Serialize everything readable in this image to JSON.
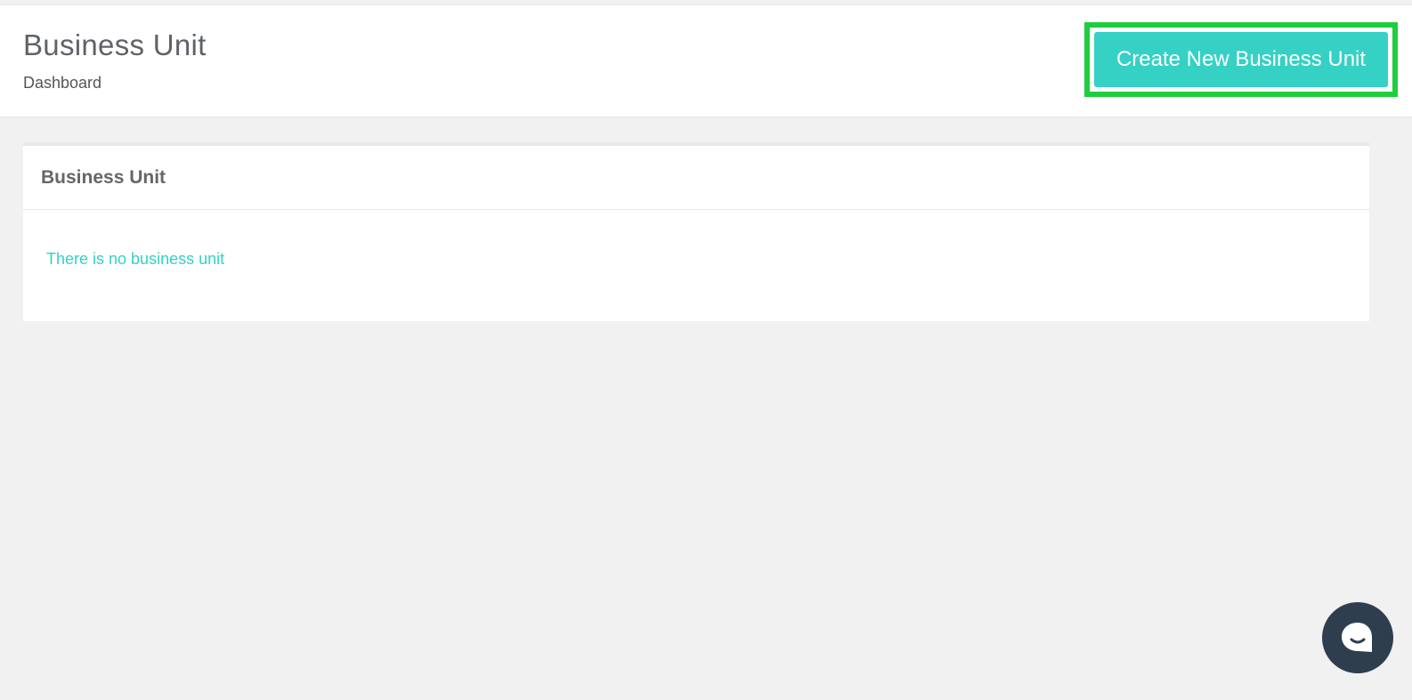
{
  "header": {
    "title": "Business Unit",
    "breadcrumb": "Dashboard",
    "create_button_label": "Create New Business Unit"
  },
  "panel": {
    "title": "Business Unit",
    "empty_message": "There is no business unit"
  },
  "chat": {
    "icon": "chat-bubble-icon"
  },
  "colors": {
    "accent": "#35d1c4",
    "highlight": "#1ece3d",
    "chat_button": "#2f3e4e"
  }
}
